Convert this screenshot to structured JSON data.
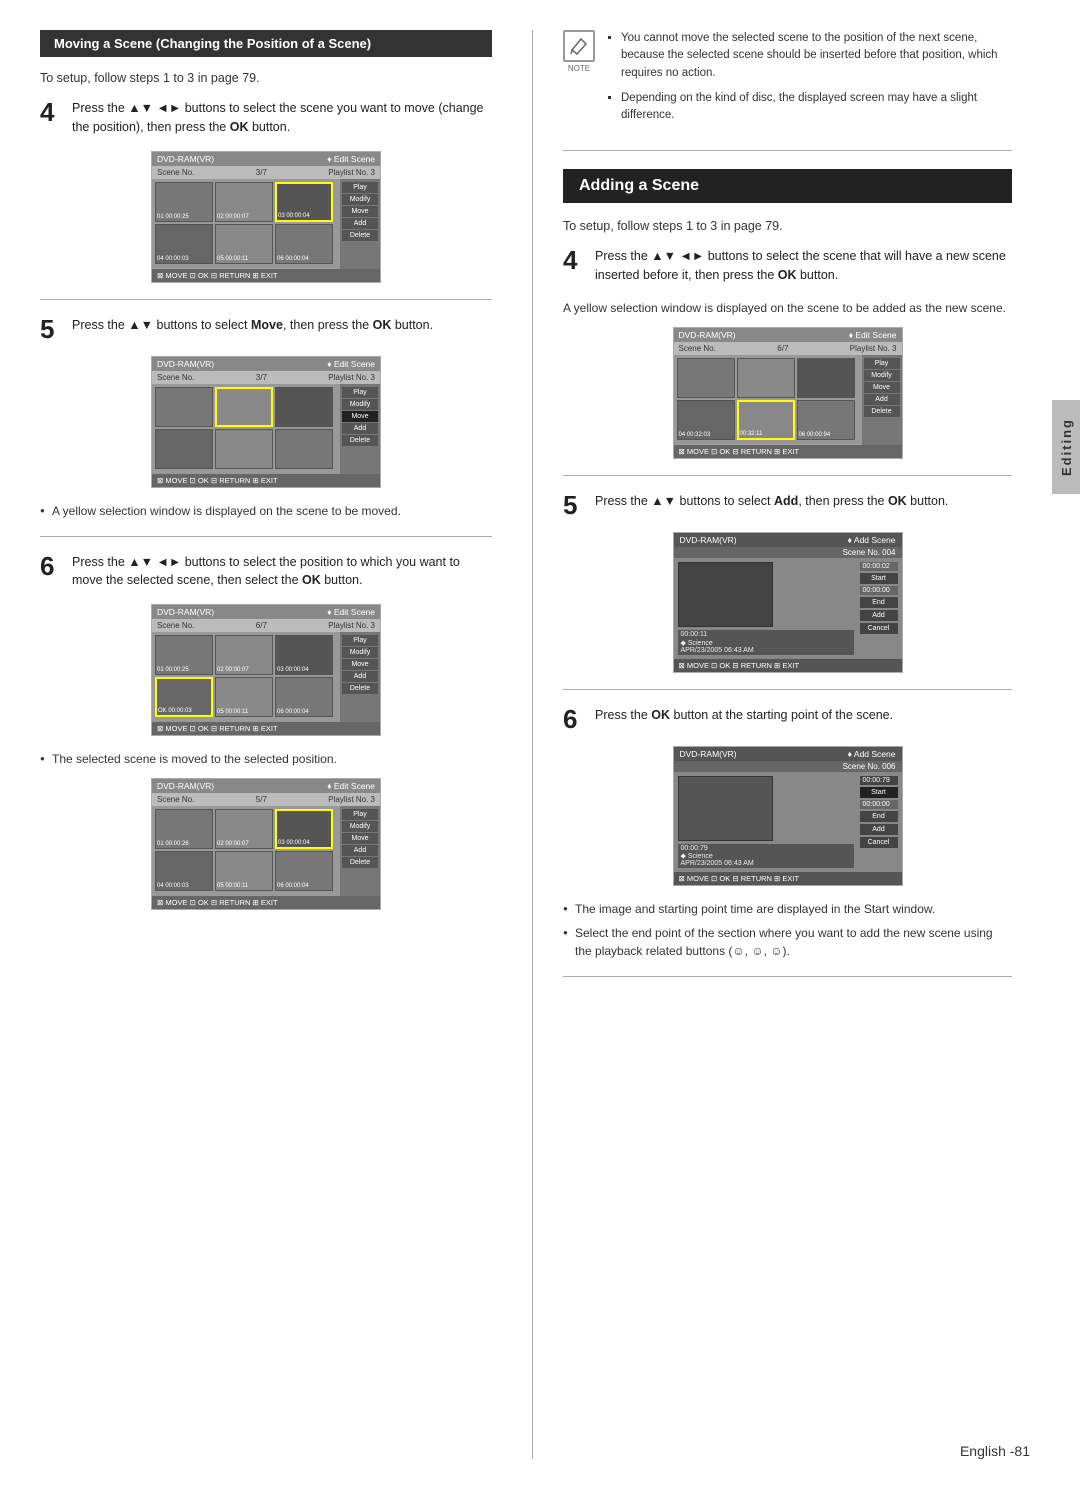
{
  "left": {
    "section_title": "Moving a Scene (Changing the Position of a Scene)",
    "setup_text": "To setup, follow steps 1 to 3 in page 79.",
    "step4": {
      "number": "4",
      "text": "Press the ▲▼ ◄► buttons to select the scene you want to move (change the position), then press the ",
      "bold": "OK",
      "text2": " button."
    },
    "screen1": {
      "header_left": "DVD-RAM(VR)",
      "header_right": "♦ Edit Scene",
      "sub_left": "Scene No.",
      "sub_mid": "3/7",
      "sub_right": "Playlist No. 3",
      "btn1": "Play",
      "btn2": "Modify",
      "btn3": "Move",
      "btn4": "Add",
      "btn5": "Delete",
      "footer": "⊠ MOVE   ⊡ OK   ⊟ RETURN   ⊞ EXIT"
    },
    "step5": {
      "number": "5",
      "text": "Press the ▲▼ buttons to select ",
      "bold": "Move",
      "text2": ", then press the ",
      "bold2": "OK",
      "text3": " button."
    },
    "screen2": {
      "header_left": "DVD-RAM(VR)",
      "header_right": "♦ Edit Scene",
      "sub_left": "Scene No.",
      "sub_mid": "3/7",
      "sub_right": "Playlist No. 3",
      "btn1": "Play",
      "btn2": "Modify",
      "btn3_active": "Move",
      "btn4": "Add",
      "btn5": "Delete",
      "footer": "⊠ MOVE   ⊡ OK   ⊟ RETURN   ⊞ EXIT"
    },
    "bullet1": "A yellow selection window is displayed on the scene to be moved.",
    "step6": {
      "number": "6",
      "text": "Press the ▲▼ ◄► buttons to select the position to which you want to move the selected scene, then select the ",
      "bold": "OK",
      "text2": " button."
    },
    "screen3": {
      "header_left": "DVD-RAM(VR)",
      "header_right": "♦ Edit Scene",
      "sub_left": "Scene No.",
      "sub_mid": "6/7",
      "sub_right": "Playlist No. 3",
      "btn1": "Play",
      "btn2": "Modify",
      "btn3": "Move",
      "btn4": "Add",
      "btn5": "Delete",
      "footer": "⊠ MOVE   ⊡ OK   ⊟ RETURN   ⊞ EXIT"
    },
    "bullet2": "The selected scene is moved to the selected position.",
    "screen4": {
      "header_left": "DVD-RAM(VR)",
      "header_right": "♦ Edit Scene",
      "sub_left": "Scene No.",
      "sub_mid": "5/7",
      "sub_right": "Playlist No. 3",
      "btn1": "Play",
      "btn2": "Modify",
      "btn3": "Move",
      "btn4": "Add",
      "btn5": "Delete",
      "footer": "⊠ MOVE   ⊡ OK   ⊟ RETURN   ⊞ EXIT"
    }
  },
  "right": {
    "note_items": [
      "You cannot move the selected scene to the position of the next scene, because the selected scene should be inserted before that position, which requires no action.",
      "Depending on the kind of disc, the displayed screen may have a slight difference."
    ],
    "section_title": "Adding a Scene",
    "setup_text": "To setup, follow steps 1 to 3 in page 79.",
    "step4": {
      "number": "4",
      "text": "Press the ▲▼ ◄► buttons to select the scene that will have a new scene inserted before it, then press the ",
      "bold": "OK",
      "text2": " button."
    },
    "step4_sub": "A yellow selection window is displayed on the scene to be added as the new scene.",
    "screen_r1": {
      "header_left": "DVD-RAM(VR)",
      "header_right": "♦ Edit Scene",
      "sub_left": "Scene No.",
      "sub_mid": "6/7",
      "sub_right": "Playlist No. 3",
      "btn1": "Play",
      "btn2": "Modify",
      "btn3": "Move",
      "btn4": "Add",
      "btn5": "Delete",
      "footer": "⊠ MOVE   ⊡ OK   ⊟ RETURN   ⊞ EXIT"
    },
    "step5": {
      "number": "5",
      "text": "Press the ▲▼ buttons to select ",
      "bold": "Add",
      "text2": ", then press the ",
      "bold2": "OK",
      "text3": " button."
    },
    "screen_add1": {
      "header_left": "DVD-RAM(VR)",
      "header_right": "♦ Add Scene",
      "scene_no": "Scene No. 004",
      "info1": "00:00:11",
      "label": "Science",
      "date": "APR/23/2005 06:43 AM",
      "btn1": "Start",
      "btn2": "End",
      "btn3": "Add",
      "btn4": "Cancel",
      "footer": "⊠ MOVE   ⊡ OK   ⊟ RETURN   ⊞ EXIT"
    },
    "step6": {
      "number": "6",
      "text": "Press the ",
      "bold": "OK",
      "text2": " button at the starting point of the scene."
    },
    "screen_add2": {
      "header_left": "DVD-RAM(VR)",
      "header_right": "♦ Add Scene",
      "scene_no": "Scene No. 006",
      "info1": "00:00:79",
      "label": "Science",
      "date": "APR/23/2005 06:43 AM",
      "btn1": "Start",
      "btn2": "End",
      "btn3": "Add",
      "btn4": "Cancel",
      "footer": "⊠ MOVE   ⊡ OK   ⊟ RETURN   ⊞ EXIT"
    },
    "bullet1": "The image and starting point time are displayed in the Start window.",
    "bullet2": "Select the end point of the section where you want to add the new scene using the playback related buttons (☺, ☺, ☺)."
  },
  "footer": {
    "text": "English -81"
  },
  "side_tab": "Editing"
}
